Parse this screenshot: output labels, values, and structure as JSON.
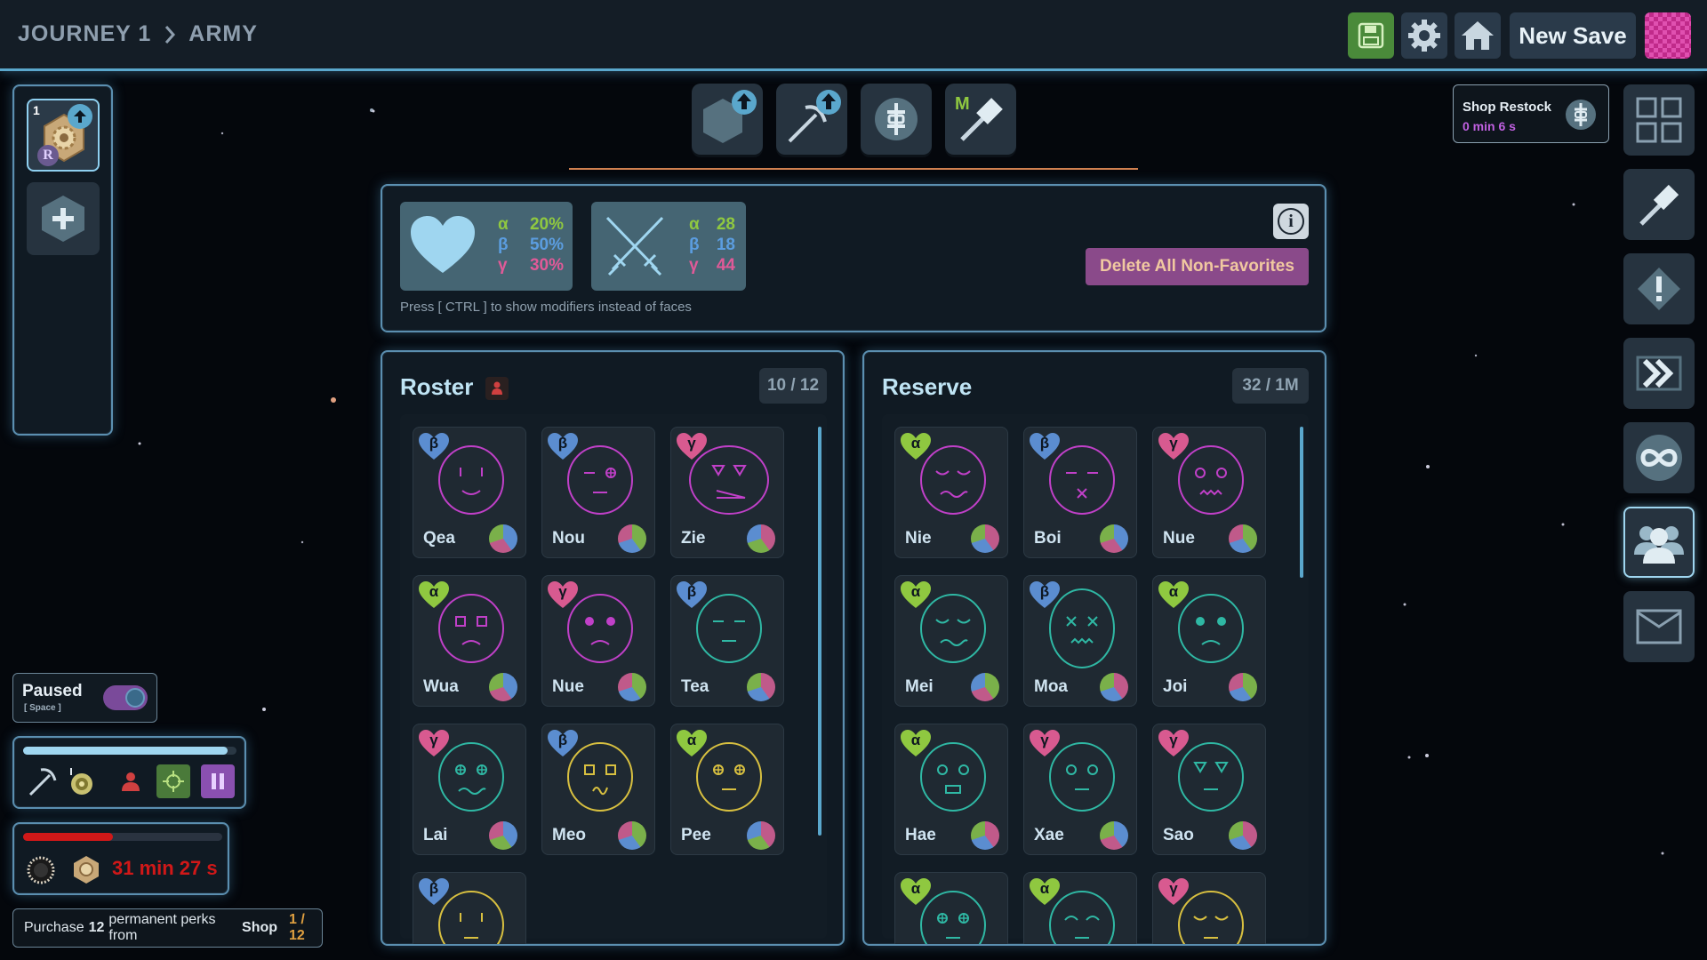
{
  "breadcrumb": {
    "journey": "JOURNEY 1",
    "section": "ARMY"
  },
  "header": {
    "new_save_label": "New Save",
    "save_icon": "floppy-disk-icon",
    "settings_icon": "gear-icon",
    "home_icon": "home-icon"
  },
  "left": {
    "slot_number": "1",
    "slot_badge": "R"
  },
  "paused": {
    "label": "Paused",
    "hint": "[ Space ]",
    "on": true
  },
  "progress": {
    "fill_fraction": 0.96
  },
  "timer": {
    "text": "31 min 27 s",
    "fill_fraction": 0.45
  },
  "quest": {
    "prefix": "Purchase",
    "count": "12",
    "middle": "permanent perks from",
    "target": "Shop",
    "progress": "1 / 12"
  },
  "tools": [
    {
      "name": "hexagon-upgrade-icon"
    },
    {
      "name": "pickaxe-upgrade-icon"
    },
    {
      "name": "currency-icon"
    },
    {
      "name": "hammer-m-icon",
      "label": "M"
    }
  ],
  "shop": {
    "title": "Shop Restock",
    "time": "0 min 6 s"
  },
  "stats": {
    "health": {
      "alpha": "20%",
      "beta": "50%",
      "gamma": "30%"
    },
    "attack": {
      "alpha": "28",
      "beta": "18",
      "gamma": "44"
    },
    "symbols": {
      "alpha": "α",
      "beta": "β",
      "gamma": "γ"
    },
    "hint": "Press [ CTRL ] to show modifiers instead of faces",
    "delete_label": "Delete All Non-Favorites",
    "info_label": "i"
  },
  "roster": {
    "title": "Roster",
    "count": "10 / 12",
    "units": [
      {
        "name": "Qea",
        "type": "β",
        "face": "#c040c8",
        "eyes": "line",
        "mouth": "smile",
        "pie": [
          "#5b8dd0",
          "#c05a8a",
          "#7ab04a"
        ]
      },
      {
        "name": "Nou",
        "type": "β",
        "face": "#c040c8",
        "eyes": "dashcross",
        "mouth": "flat",
        "pie": [
          "#7ab04a",
          "#5b8dd0",
          "#c05a8a"
        ]
      },
      {
        "name": "Zie",
        "type": "γ",
        "face": "#c040c8",
        "eyes": "triangle",
        "mouth": "wedge",
        "pie": [
          "#c05a8a",
          "#7ab04a",
          "#5b8dd0"
        ]
      },
      {
        "name": "Wua",
        "type": "α",
        "face": "#c040c8",
        "eyes": "square",
        "mouth": "frown",
        "pie": [
          "#5b8dd0",
          "#c05a8a",
          "#7ab04a"
        ]
      },
      {
        "name": "Nue",
        "type": "γ",
        "face": "#c040c8",
        "eyes": "dot",
        "mouth": "frown",
        "pie": [
          "#7ab04a",
          "#5b8dd0",
          "#c05a8a"
        ]
      },
      {
        "name": "Tea",
        "type": "β",
        "face": "#2fb8a4",
        "eyes": "dash",
        "mouth": "flat",
        "pie": [
          "#c05a8a",
          "#5b8dd0",
          "#7ab04a"
        ]
      },
      {
        "name": "Lai",
        "type": "γ",
        "face": "#2fb8a4",
        "eyes": "crosshair",
        "mouth": "wave",
        "pie": [
          "#5b8dd0",
          "#7ab04a",
          "#c05a8a"
        ]
      },
      {
        "name": "Meo",
        "type": "β",
        "face": "#d8c040",
        "eyes": "square",
        "mouth": "squiggle",
        "pie": [
          "#7ab04a",
          "#5b8dd0",
          "#c05a8a"
        ]
      },
      {
        "name": "Pee",
        "type": "α",
        "face": "#d8c040",
        "eyes": "crosshair",
        "mouth": "flat",
        "pie": [
          "#c05a8a",
          "#7ab04a",
          "#5b8dd0"
        ]
      },
      {
        "name": "",
        "type": "β",
        "face": "#d8c040",
        "eyes": "line",
        "mouth": "flat",
        "pie": [
          "#5b8dd0",
          "#c05a8a",
          "#7ab04a"
        ]
      }
    ]
  },
  "reserve": {
    "title": "Reserve",
    "count": "32 / 1M",
    "units": [
      {
        "name": "Nie",
        "type": "α",
        "face": "#c040c8",
        "eyes": "closed",
        "mouth": "wave",
        "pie": [
          "#c05a8a",
          "#5b8dd0",
          "#7ab04a"
        ]
      },
      {
        "name": "Boi",
        "type": "β",
        "face": "#c040c8",
        "eyes": "dash",
        "mouth": "x",
        "pie": [
          "#5b8dd0",
          "#c05a8a",
          "#7ab04a"
        ]
      },
      {
        "name": "Nue",
        "type": "γ",
        "face": "#c040c8",
        "eyes": "ring",
        "mouth": "zigzag",
        "pie": [
          "#7ab04a",
          "#5b8dd0",
          "#c05a8a"
        ]
      },
      {
        "name": "Mei",
        "type": "α",
        "face": "#2fb8a4",
        "eyes": "closed",
        "mouth": "wave",
        "pie": [
          "#7ab04a",
          "#c05a8a",
          "#5b8dd0"
        ]
      },
      {
        "name": "Moa",
        "type": "β",
        "face": "#2fb8a4",
        "eyes": "xx",
        "mouth": "zigzag",
        "pie": [
          "#c05a8a",
          "#5b8dd0",
          "#7ab04a"
        ]
      },
      {
        "name": "Joi",
        "type": "α",
        "face": "#2fb8a4",
        "eyes": "dot",
        "mouth": "frown",
        "pie": [
          "#7ab04a",
          "#5b8dd0",
          "#c05a8a"
        ]
      },
      {
        "name": "Hae",
        "type": "α",
        "face": "#2fb8a4",
        "eyes": "ring",
        "mouth": "box",
        "pie": [
          "#c05a8a",
          "#5b8dd0",
          "#7ab04a"
        ]
      },
      {
        "name": "Xae",
        "type": "γ",
        "face": "#2fb8a4",
        "eyes": "ring",
        "mouth": "flat",
        "pie": [
          "#5b8dd0",
          "#c05a8a",
          "#7ab04a"
        ]
      },
      {
        "name": "Sao",
        "type": "γ",
        "face": "#2fb8a4",
        "eyes": "triangle",
        "mouth": "flat",
        "pie": [
          "#c05a8a",
          "#5b8dd0",
          "#7ab04a"
        ]
      },
      {
        "name": "",
        "type": "α",
        "face": "#2fb8a4",
        "eyes": "crosshair",
        "mouth": "flat",
        "pie": [
          "#7ab04a",
          "#5b8dd0",
          "#c05a8a"
        ]
      },
      {
        "name": "",
        "type": "α",
        "face": "#2fb8a4",
        "eyes": "arc",
        "mouth": "flat",
        "pie": [
          "#5b8dd0",
          "#7ab04a",
          "#c05a8a"
        ]
      },
      {
        "name": "",
        "type": "γ",
        "face": "#d8c040",
        "eyes": "closed",
        "mouth": "flat",
        "pie": [
          "#c05a8a",
          "#7ab04a",
          "#5b8dd0"
        ]
      }
    ]
  },
  "colors": {
    "alpha": "#8fc840",
    "beta": "#5b8dd0",
    "gamma": "#d85a90",
    "accent": "#5aa7cc"
  }
}
